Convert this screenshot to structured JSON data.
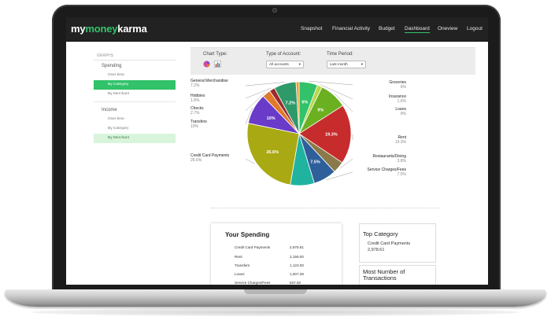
{
  "app": {
    "logo_part1": "my",
    "logo_part2": "money",
    "logo_part3": "karma"
  },
  "nav": [
    {
      "label": "Snapshot"
    },
    {
      "label": "Financial Activity"
    },
    {
      "label": "Budget"
    },
    {
      "label": "Dashboard",
      "active": true
    },
    {
      "label": "Oneview"
    },
    {
      "label": "Logout"
    }
  ],
  "sidebar": {
    "heading": "GRAPHS",
    "spending": {
      "label": "Spending",
      "items": [
        "Over time",
        "By Category",
        "By Merchant"
      ],
      "selected": "By Category"
    },
    "income": {
      "label": "Income",
      "items": [
        "Over time",
        "By Category",
        "By Merchant"
      ],
      "selected": "By Merchant"
    }
  },
  "filters": {
    "chart_type_label": "Chart Type:",
    "account_label": "Type of Account:",
    "account_value": "All accounts",
    "period_label": "Time Period:",
    "period_value": "Last month"
  },
  "chart_data": {
    "type": "pie",
    "slices": [
      {
        "name": "Groceries",
        "pct": 6.0,
        "color": "#31c26a"
      },
      {
        "name": "Insurance",
        "pct": 1.6,
        "color": "#b7d84a"
      },
      {
        "name": "Loans",
        "pct": 9.0,
        "color": "#6bb021"
      },
      {
        "name": "Rent",
        "pct": 19.3,
        "color": "#c62c2c"
      },
      {
        "name": "Restaurants/Dining",
        "pct": 3.8,
        "color": "#8a7a4a"
      },
      {
        "name": "Service Charges/Fees",
        "pct": 7.5,
        "color": "#2f5f9a"
      },
      {
        "name": "",
        "pct": 7.8,
        "color": "#1fb3a0"
      },
      {
        "name": "Credit Card Payments",
        "pct": 26.6,
        "color": "#a9aa13"
      },
      {
        "name": "Transfers",
        "pct": 10.0,
        "color": "#6a3bc9"
      },
      {
        "name": "Checks",
        "pct": 2.7,
        "color": "#e07a2a"
      },
      {
        "name": "Hobbies",
        "pct": 1.8,
        "color": "#9a2c2c"
      },
      {
        "name": "General Merchandise",
        "pct": 7.2,
        "color": "#2e9a6a"
      },
      {
        "name": "",
        "pct": 1.0,
        "color": "#f0a02a"
      }
    ],
    "slice_labels": [
      "6%",
      "9%",
      "19.3%",
      "7.5%",
      "26.6%",
      "10%",
      "7.2%"
    ]
  },
  "labels_left": [
    {
      "name": "General Merchandise",
      "pct": "7.2%"
    },
    {
      "name": "Hobbies",
      "pct": "1.8%"
    },
    {
      "name": "Checks",
      "pct": "2.7%"
    },
    {
      "name": "Transfers",
      "pct": "10%"
    },
    {
      "name": "Credit Card Payments",
      "pct": "26.6%"
    }
  ],
  "labels_right": [
    {
      "name": "Groceries",
      "pct": "6%"
    },
    {
      "name": "Insurance",
      "pct": "1.6%"
    },
    {
      "name": "Loans",
      "pct": "9%"
    },
    {
      "name": "Rent",
      "pct": "19.3%"
    },
    {
      "name": "Restaurants/Dining",
      "pct": "3.8%"
    },
    {
      "name": "Service Charges/Fees",
      "pct": "7.5%"
    }
  ],
  "spending": {
    "title": "Your Spending",
    "rows": [
      {
        "name": "Credit Card Payments",
        "amount": "2,978.61"
      },
      {
        "name": "Rent",
        "amount": "2,159.00"
      },
      {
        "name": "Transfers",
        "amount": "1,123.00"
      },
      {
        "name": "Loans",
        "amount": "1,007.39"
      },
      {
        "name": "Service Charges/Fees",
        "amount": "837.50"
      }
    ]
  },
  "top_category": {
    "title": "Top Category",
    "name": "Credit Card Payments",
    "amount": "2,978.61"
  },
  "most_transactions": {
    "title": "Most Number of Transactions"
  }
}
